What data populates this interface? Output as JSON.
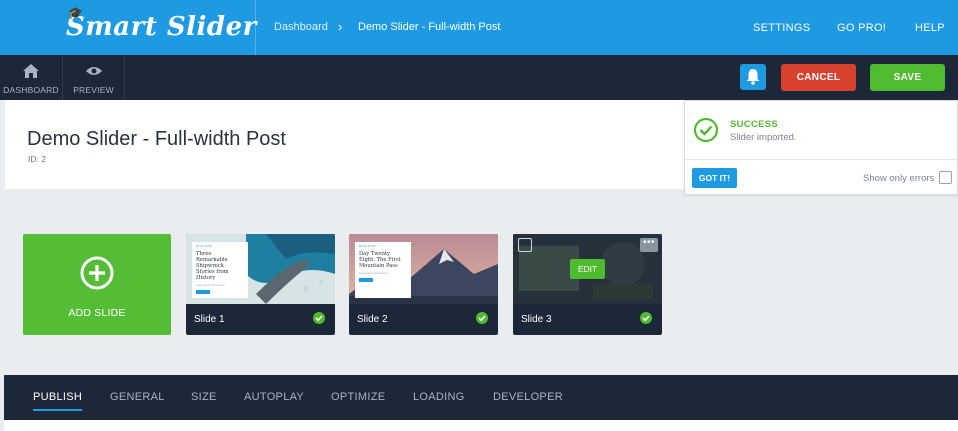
{
  "app": {
    "logo_text": "Smart Slider"
  },
  "breadcrumb": {
    "home": "Dashboard",
    "separator": "›",
    "current": "Demo Slider - Full-width Post"
  },
  "topnav": {
    "settings": "SETTINGS",
    "gopro": "GO PRO!",
    "help": "HELP"
  },
  "toolbar": {
    "dashboard_label": "DASHBOARD",
    "preview_label": "PREVIEW",
    "cancel_label": "CANCEL",
    "save_label": "SAVE"
  },
  "page": {
    "title": "Demo Slider - Full-width Post",
    "id_text": "ID: 2"
  },
  "notification": {
    "title": "SUCCESS",
    "message": "Slider imported.",
    "got_it": "GOT IT!",
    "show_only_errors": "Show only errors"
  },
  "slides": {
    "add_label": "ADD SLIDE",
    "items": [
      {
        "name": "Slide 1",
        "card_heading": "Three Remarkable Shipwreck Stories from History"
      },
      {
        "name": "Slide 2",
        "card_heading": "Day Twenty Eight: The First Mountain Pass"
      },
      {
        "name": "Slide 3",
        "edit_label": "EDIT"
      }
    ]
  },
  "tabs": [
    "PUBLISH",
    "GENERAL",
    "SIZE",
    "AUTOPLAY",
    "OPTIMIZE",
    "LOADING",
    "DEVELOPER"
  ],
  "colors": {
    "primary": "#1d9ae2",
    "dark": "#1c2837",
    "success": "#4fbb2f",
    "danger": "#d9412f"
  }
}
